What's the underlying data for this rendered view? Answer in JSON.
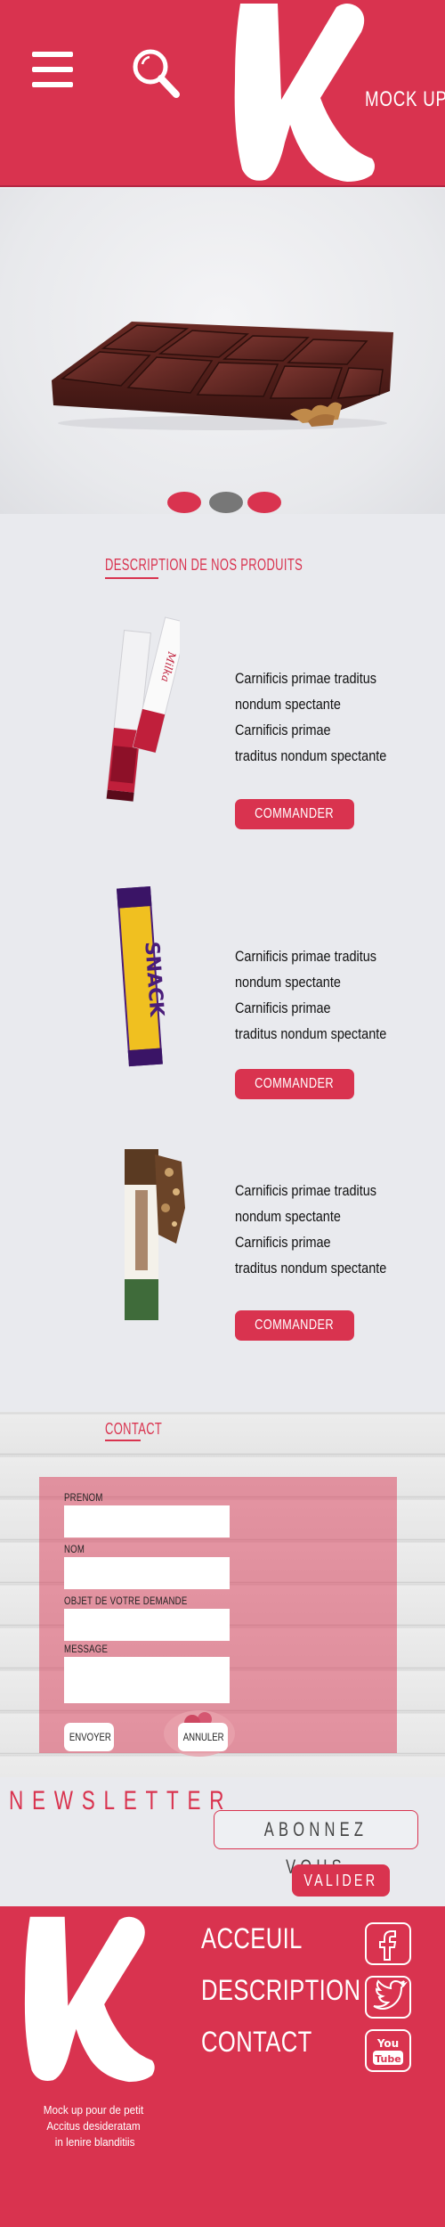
{
  "header": {
    "brand": "MOCK UP",
    "icons": [
      "menu-icon",
      "search-icon",
      "vk-logo"
    ],
    "brand_color": "#d9334f"
  },
  "hero": {
    "carousel_dots": [
      {
        "color": "#d9334f",
        "active": true
      },
      {
        "color": "#777777",
        "active": false
      },
      {
        "color": "#d9334f",
        "active": false
      }
    ]
  },
  "products": {
    "title": "DESCRIPTION DE NOS PRODUITS",
    "items": [
      {
        "lines": [
          "Carnificis primae traditus",
          "nondum spectante",
          "Carnificis primae",
          " traditus nondum spectante"
        ],
        "button": "COMMANDER",
        "image": "milka-stick-wrapper"
      },
      {
        "lines": [
          "Carnificis primae traditus",
          "nondum spectante",
          "Carnificis primae",
          " traditus nondum spectante"
        ],
        "button": "COMMANDER",
        "image": "snack-bar-wrapper"
      },
      {
        "lines": [
          "Carnificis primae traditus",
          "nondum spectante",
          "Carnificis primae",
          " traditus nondum spectante"
        ],
        "button": "COMMANDER",
        "image": "nut-chocolate-bar-wrapper"
      }
    ]
  },
  "contact": {
    "title": "CONTACT",
    "fields": {
      "prenom": "PRENOM",
      "nom": "NOM",
      "objet": "OBJET DE VOTRE DEMANDE",
      "message": "MESSAGE"
    },
    "submit": "ENVOYER",
    "cancel": "ANNULER"
  },
  "newsletter": {
    "title": "NEWSLETTER",
    "input_text": "ABONNEZ VOUS",
    "button": "VALIDER"
  },
  "footer": {
    "nav": [
      "ACCEUIL",
      "DESCRIPTION",
      "CONTACT"
    ],
    "social": [
      "facebook-icon",
      "twitter-icon",
      "youtube-icon"
    ],
    "youtube_you": "You",
    "youtube_tube": "Tube",
    "text_lines": [
      "Mock up pour de petit",
      "Accitus desideratam",
      " in lenire blanditiis"
    ]
  }
}
